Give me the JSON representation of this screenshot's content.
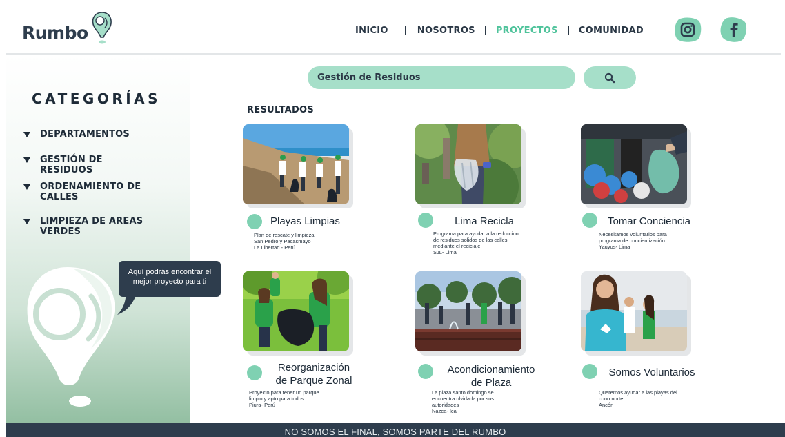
{
  "brand": {
    "name": "Rumbo",
    "accent": "#4fc39b",
    "mint": "#a6dfc9",
    "navy": "#2e3d4d"
  },
  "nav": {
    "items": [
      {
        "label": "INICIO",
        "active": false
      },
      {
        "label": "NOSOTROS",
        "active": false
      },
      {
        "label": "PROYECTOS",
        "active": true
      },
      {
        "label": "COMUNIDAD",
        "active": false
      }
    ],
    "social": [
      {
        "icon": "instagram-icon"
      },
      {
        "icon": "facebook-icon"
      }
    ]
  },
  "sidebar": {
    "title": "CATEGORÍAS",
    "items": [
      {
        "label": "DEPARTAMENTOS"
      },
      {
        "label": "GESTIÓN DE RESIDUOS"
      },
      {
        "label": "ORDENAMIENTO DE CALLES"
      },
      {
        "label": "LIMPIEZA DE AREAS VERDES"
      }
    ],
    "bubble": "Aquí podrás encontrar el mejor proyecto para ti"
  },
  "search": {
    "value": "Gestión de Residuos",
    "icon": "search-icon"
  },
  "results": {
    "title": "RESULTADOS",
    "cards": [
      {
        "title": "Playas Limpias",
        "desc": "Plan de rescate y limpieza.\nSan Pedro y Pacasmayo\nLa Libertad - Perú"
      },
      {
        "title": "Lima Recicla",
        "desc": "Programa para ayudar a la reduccion\nde residuos solidos de las calles\nmediante el reciclaje\nSJL- Lima"
      },
      {
        "title": "Tomar Conciencia",
        "desc": "Necesitamos voluntarios para\nprograma de concientización.\nYauyos- Lima"
      },
      {
        "title": "Reorganización\nde Parque Zonal",
        "desc": "Proyecto para tener un parque\nlimpio y apto para todos.\nPiura- Perú"
      },
      {
        "title": "Acondicionamiento\nde Plaza",
        "desc": "La plaza santo domingo se\nencuentra olvidada por sus\nautoridades\nNazca- Ica"
      },
      {
        "title": "Somos Voluntarios",
        "desc": "Queremos ayudar a las playas del\ncono norte\nAncón"
      }
    ]
  },
  "footer": {
    "text": "NO SOMOS EL FINAL, SOMOS PARTE DEL RUMBO"
  }
}
